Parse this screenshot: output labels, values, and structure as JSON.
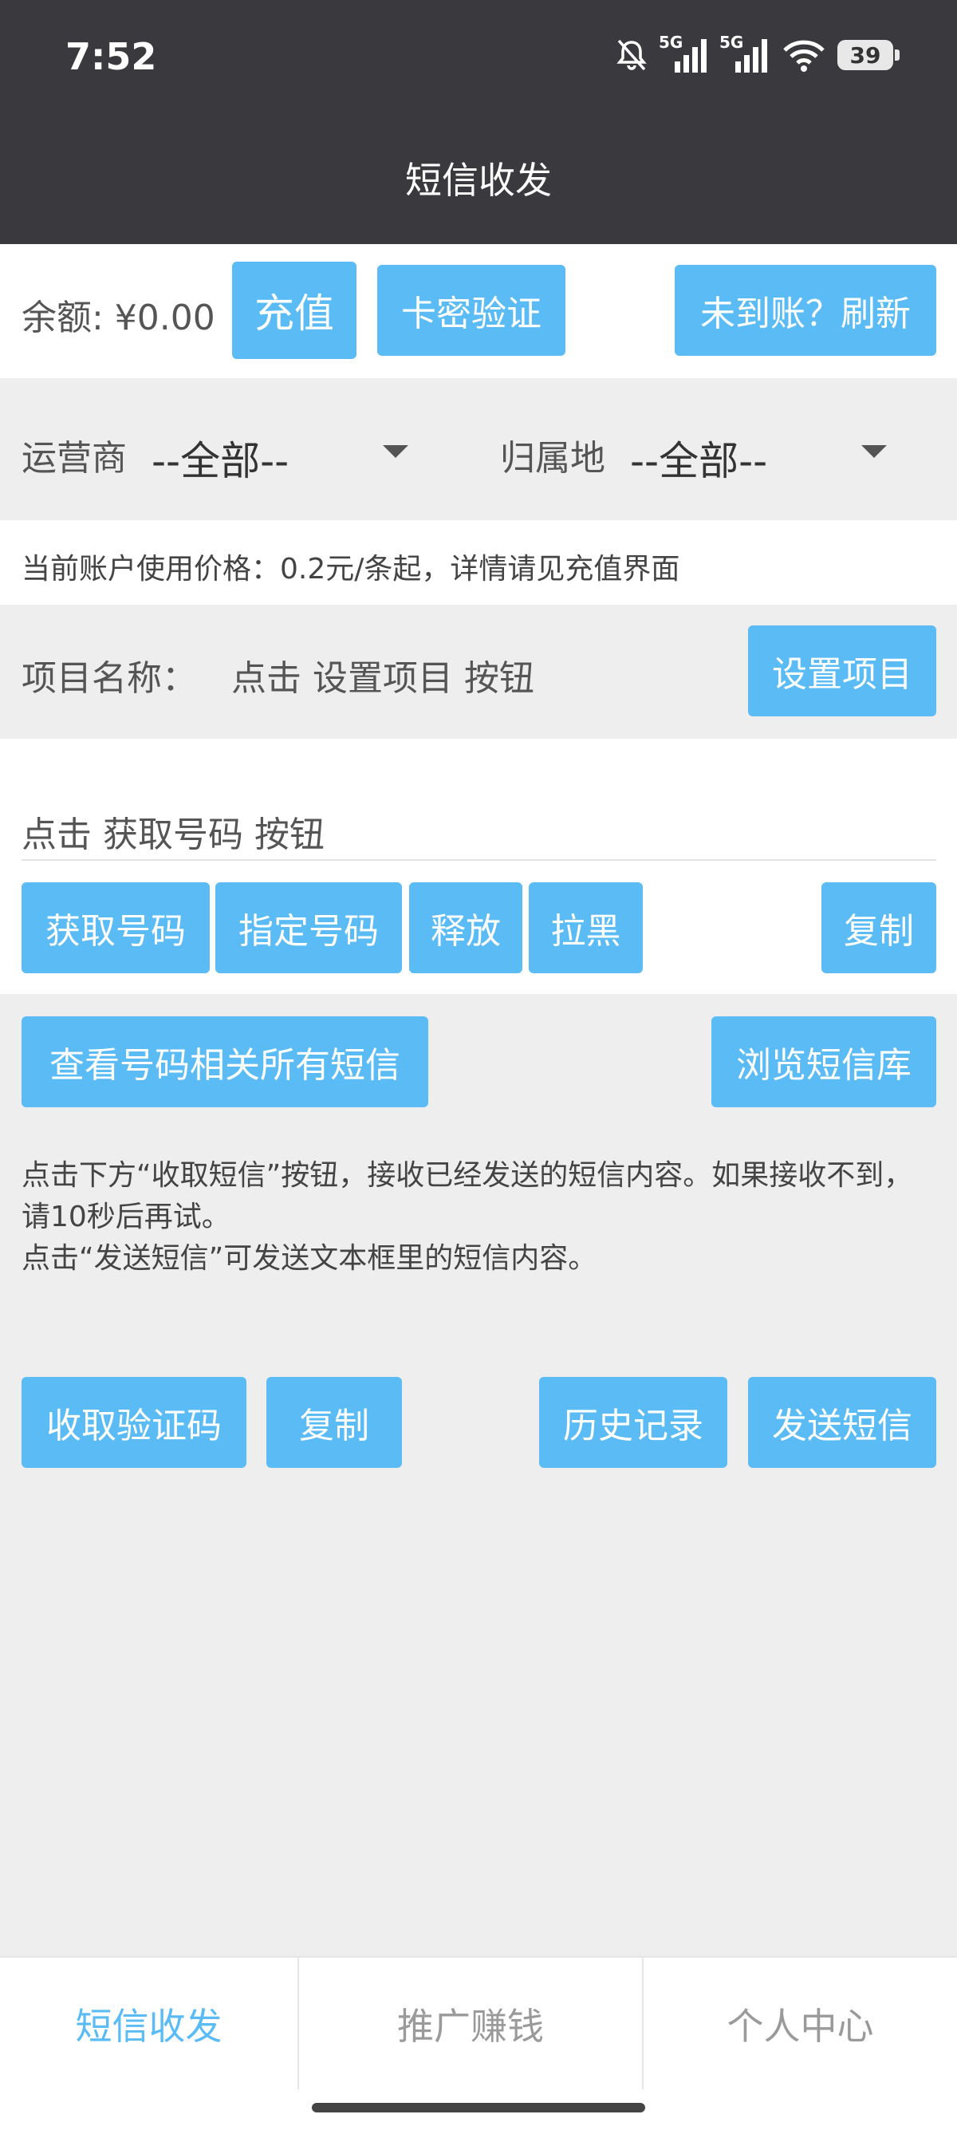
{
  "status": {
    "time": "7:52",
    "battery": "39",
    "sig1_label": "5G",
    "sig2_label": "5G"
  },
  "header": {
    "title": "短信收发"
  },
  "balance": {
    "label": "余额: ¥0.00",
    "recharge": "充值",
    "card_verify": "卡密验证",
    "refresh": "未到账？刷新"
  },
  "filters": {
    "carrier_label": "运营商",
    "carrier_value": "--全部--",
    "region_label": "归属地",
    "region_value": "--全部--"
  },
  "price_note": "当前账户使用价格：0.2元/条起，详情请见充值界面",
  "project": {
    "label": "项目名称：",
    "value": "点击 设置项目 按钮",
    "set_button": "设置项目"
  },
  "number": {
    "placeholder": "点击 获取号码 按钮",
    "get": "获取号码",
    "specify": "指定号码",
    "release": "释放",
    "blacklist": "拉黑",
    "copy": "复制"
  },
  "sms": {
    "view_all": "查看号码相关所有短信",
    "browse_lib": "浏览短信库",
    "info_line1": "点击下方“收取短信”按钮，接收已经发送的短信内容。如果接收不到，请10秒后再试。",
    "info_line2": "点击“发送短信”可发送文本框里的短信内容。",
    "receive_code": "收取验证码",
    "copy": "复制",
    "history": "历史记录",
    "send": "发送短信"
  },
  "tabs": [
    {
      "label": "短信收发"
    },
    {
      "label": "推广赚钱"
    },
    {
      "label": "个人中心"
    }
  ],
  "colors": {
    "accent": "#5bbcf5",
    "header_bg": "#3a3a3e"
  }
}
